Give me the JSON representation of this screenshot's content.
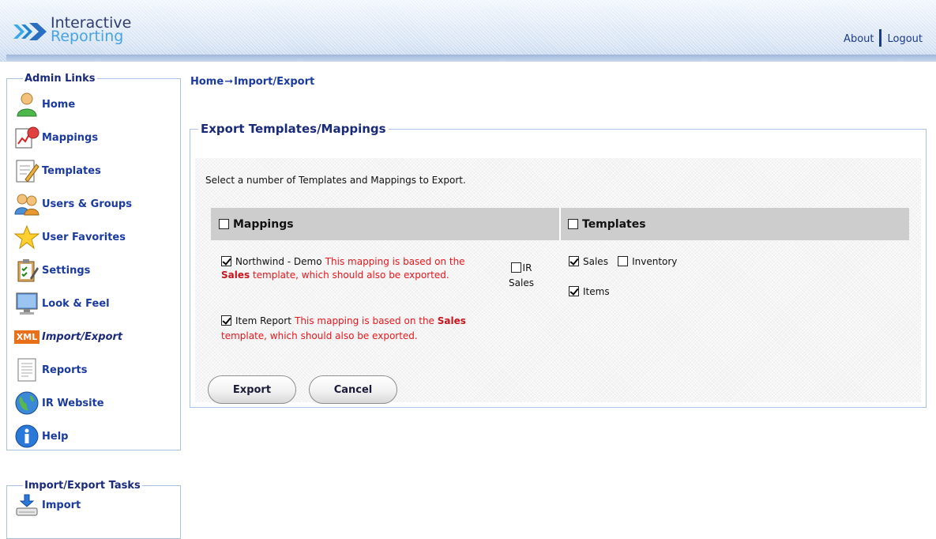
{
  "app": {
    "logo_line1": "Interactive",
    "logo_line2": "Reporting",
    "about": "About",
    "logout": "Logout"
  },
  "sidebar": {
    "admin_title": "Admin Links",
    "items": [
      {
        "label": "Home",
        "icon": "home-user-icon"
      },
      {
        "label": "Mappings",
        "icon": "mappings-icon"
      },
      {
        "label": "Templates",
        "icon": "templates-icon"
      },
      {
        "label": "Users & Groups",
        "icon": "users-groups-icon"
      },
      {
        "label": "User Favorites",
        "icon": "star-icon"
      },
      {
        "label": "Settings",
        "icon": "settings-clipboard-icon"
      },
      {
        "label": "Look & Feel",
        "icon": "monitor-icon"
      },
      {
        "label": "Import/Export",
        "icon": "xml-icon",
        "badge": "XML",
        "active": true
      },
      {
        "label": "Reports",
        "icon": "reports-icon"
      },
      {
        "label": "IR Website",
        "icon": "globe-icon"
      },
      {
        "label": "Help",
        "icon": "info-icon"
      }
    ],
    "tasks_title": "Import/Export Tasks",
    "task_items": [
      {
        "label": "Import",
        "icon": "import-icon"
      }
    ]
  },
  "breadcrumb": {
    "home": "Home",
    "arrow": "➞",
    "current": "Import/Export"
  },
  "export_panel": {
    "title": "Export Templates/Mappings",
    "instructions": "Select a number of Templates and Mappings to Export.",
    "mappings_header": "Mappings",
    "templates_header": "Templates",
    "mappings": [
      {
        "name": "Northwind - Demo",
        "checked": true,
        "note_pre": "This mapping is based on the ",
        "note_bold": "Sales",
        "note_post": " template, which should also be exported."
      },
      {
        "name": "Item Report",
        "checked": true,
        "note_pre": "This mapping is based on the ",
        "note_bold": "Sales",
        "note_post": " template, which should also be exported."
      },
      {
        "name": "IR Sales",
        "checked": false
      }
    ],
    "templates": [
      {
        "name": "Sales",
        "checked": true
      },
      {
        "name": "Inventory",
        "checked": false
      },
      {
        "name": "Items",
        "checked": true
      }
    ],
    "export_button": "Export",
    "cancel_button": "Cancel"
  },
  "colors": {
    "link": "#1a3aa0",
    "warning": "#e8161b",
    "border": "#a9c2e4"
  }
}
